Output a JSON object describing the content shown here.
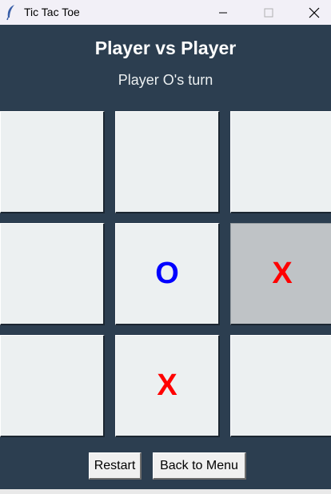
{
  "window": {
    "title": "Tic Tac Toe"
  },
  "header": {
    "title": "Player vs Player",
    "status": "Player O's turn"
  },
  "board": {
    "cells": [
      "",
      "",
      "",
      "",
      "O",
      "X",
      "",
      "X",
      ""
    ],
    "highlighted_cell": 5
  },
  "buttons": {
    "restart": "Restart",
    "back": "Back to Menu"
  },
  "colors": {
    "background": "#2c3e50",
    "cell": "#ecf0f1",
    "cell_active": "#bfc3c6",
    "x_mark": "#ff0000",
    "o_mark": "#0000ff"
  }
}
